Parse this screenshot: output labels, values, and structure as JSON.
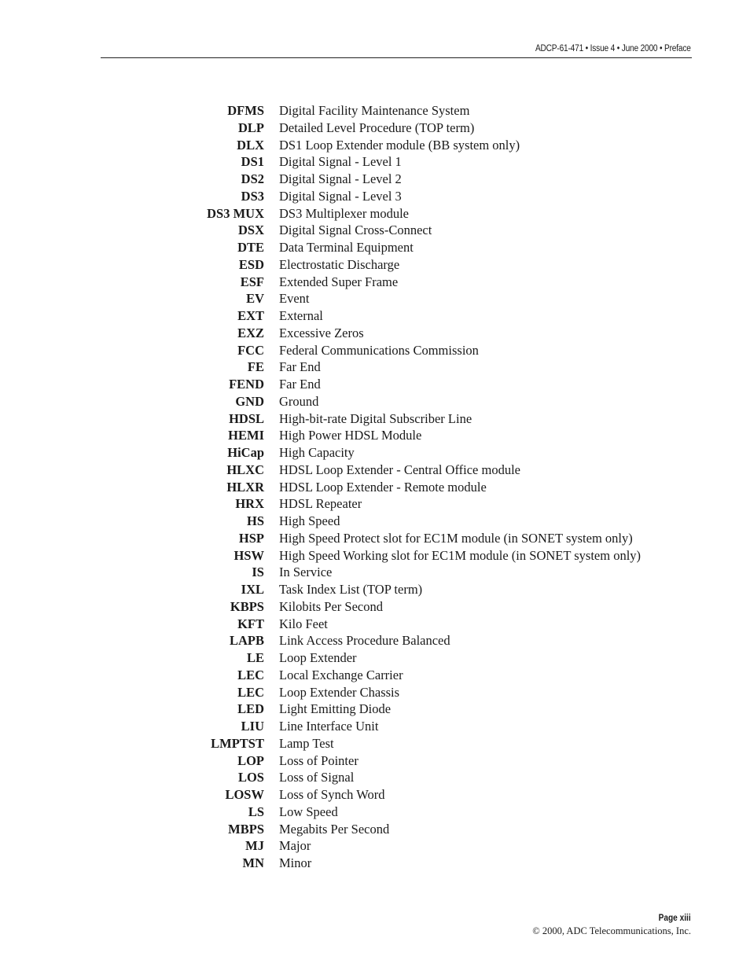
{
  "header": {
    "text": "ADCP-61-471 • Issue 4 • June 2000 • Preface"
  },
  "abbreviations": [
    {
      "abbr": "DFMS",
      "definition": "Digital Facility Maintenance System"
    },
    {
      "abbr": "DLP",
      "definition": "Detailed Level Procedure (TOP term)"
    },
    {
      "abbr": "DLX",
      "definition": "DS1 Loop Extender module (BB system only)"
    },
    {
      "abbr": "DS1",
      "definition": "Digital Signal - Level 1"
    },
    {
      "abbr": "DS2",
      "definition": "Digital Signal - Level 2"
    },
    {
      "abbr": "DS3",
      "definition": "Digital Signal - Level 3"
    },
    {
      "abbr": "DS3 MUX",
      "definition": "DS3 Multiplexer module"
    },
    {
      "abbr": "DSX",
      "definition": "Digital Signal Cross-Connect"
    },
    {
      "abbr": "DTE",
      "definition": "Data Terminal Equipment"
    },
    {
      "abbr": "ESD",
      "definition": "Electrostatic Discharge"
    },
    {
      "abbr": "ESF",
      "definition": "Extended Super Frame"
    },
    {
      "abbr": "EV",
      "definition": "Event"
    },
    {
      "abbr": "EXT",
      "definition": "External"
    },
    {
      "abbr": "EXZ",
      "definition": "Excessive Zeros"
    },
    {
      "abbr": "FCC",
      "definition": "Federal Communications Commission"
    },
    {
      "abbr": "FE",
      "definition": "Far End"
    },
    {
      "abbr": "FEND",
      "definition": "Far End"
    },
    {
      "abbr": "GND",
      "definition": "Ground"
    },
    {
      "abbr": "HDSL",
      "definition": "High-bit-rate Digital Subscriber Line"
    },
    {
      "abbr": "HEMI",
      "definition": "High Power HDSL Module"
    },
    {
      "abbr": "HiCap",
      "definition": "High Capacity"
    },
    {
      "abbr": "HLXC",
      "definition": "HDSL Loop Extender - Central Office module"
    },
    {
      "abbr": "HLXR",
      "definition": "HDSL Loop Extender - Remote module"
    },
    {
      "abbr": "HRX",
      "definition": "HDSL Repeater"
    },
    {
      "abbr": "HS",
      "definition": "High Speed"
    },
    {
      "abbr": "HSP",
      "definition": "High Speed Protect slot for EC1M module (in SONET system only)"
    },
    {
      "abbr": "HSW",
      "definition": "High Speed Working slot for EC1M module (in SONET system only)"
    },
    {
      "abbr": "IS",
      "definition": "In Service"
    },
    {
      "abbr": "IXL",
      "definition": "Task Index List (TOP term)"
    },
    {
      "abbr": "KBPS",
      "definition": "Kilobits Per Second"
    },
    {
      "abbr": "KFT",
      "definition": "Kilo Feet"
    },
    {
      "abbr": "LAPB",
      "definition": "Link Access Procedure Balanced"
    },
    {
      "abbr": "LE",
      "definition": "Loop Extender"
    },
    {
      "abbr": "LEC",
      "definition": "Local Exchange Carrier"
    },
    {
      "abbr": "LEC",
      "definition": "Loop Extender Chassis"
    },
    {
      "abbr": "LED",
      "definition": "Light Emitting Diode"
    },
    {
      "abbr": "LIU",
      "definition": "Line Interface Unit"
    },
    {
      "abbr": "LMPTST",
      "definition": "Lamp Test"
    },
    {
      "abbr": "LOP",
      "definition": "Loss of Pointer"
    },
    {
      "abbr": "LOS",
      "definition": "Loss of Signal"
    },
    {
      "abbr": "LOSW",
      "definition": "Loss of Synch Word"
    },
    {
      "abbr": "LS",
      "definition": "Low Speed"
    },
    {
      "abbr": "MBPS",
      "definition": "Megabits Per Second"
    },
    {
      "abbr": "MJ",
      "definition": "Major"
    },
    {
      "abbr": "MN",
      "definition": "Minor"
    }
  ],
  "footer": {
    "page": "Page xiii",
    "copyright": "© 2000, ADC Telecommunications, Inc."
  }
}
